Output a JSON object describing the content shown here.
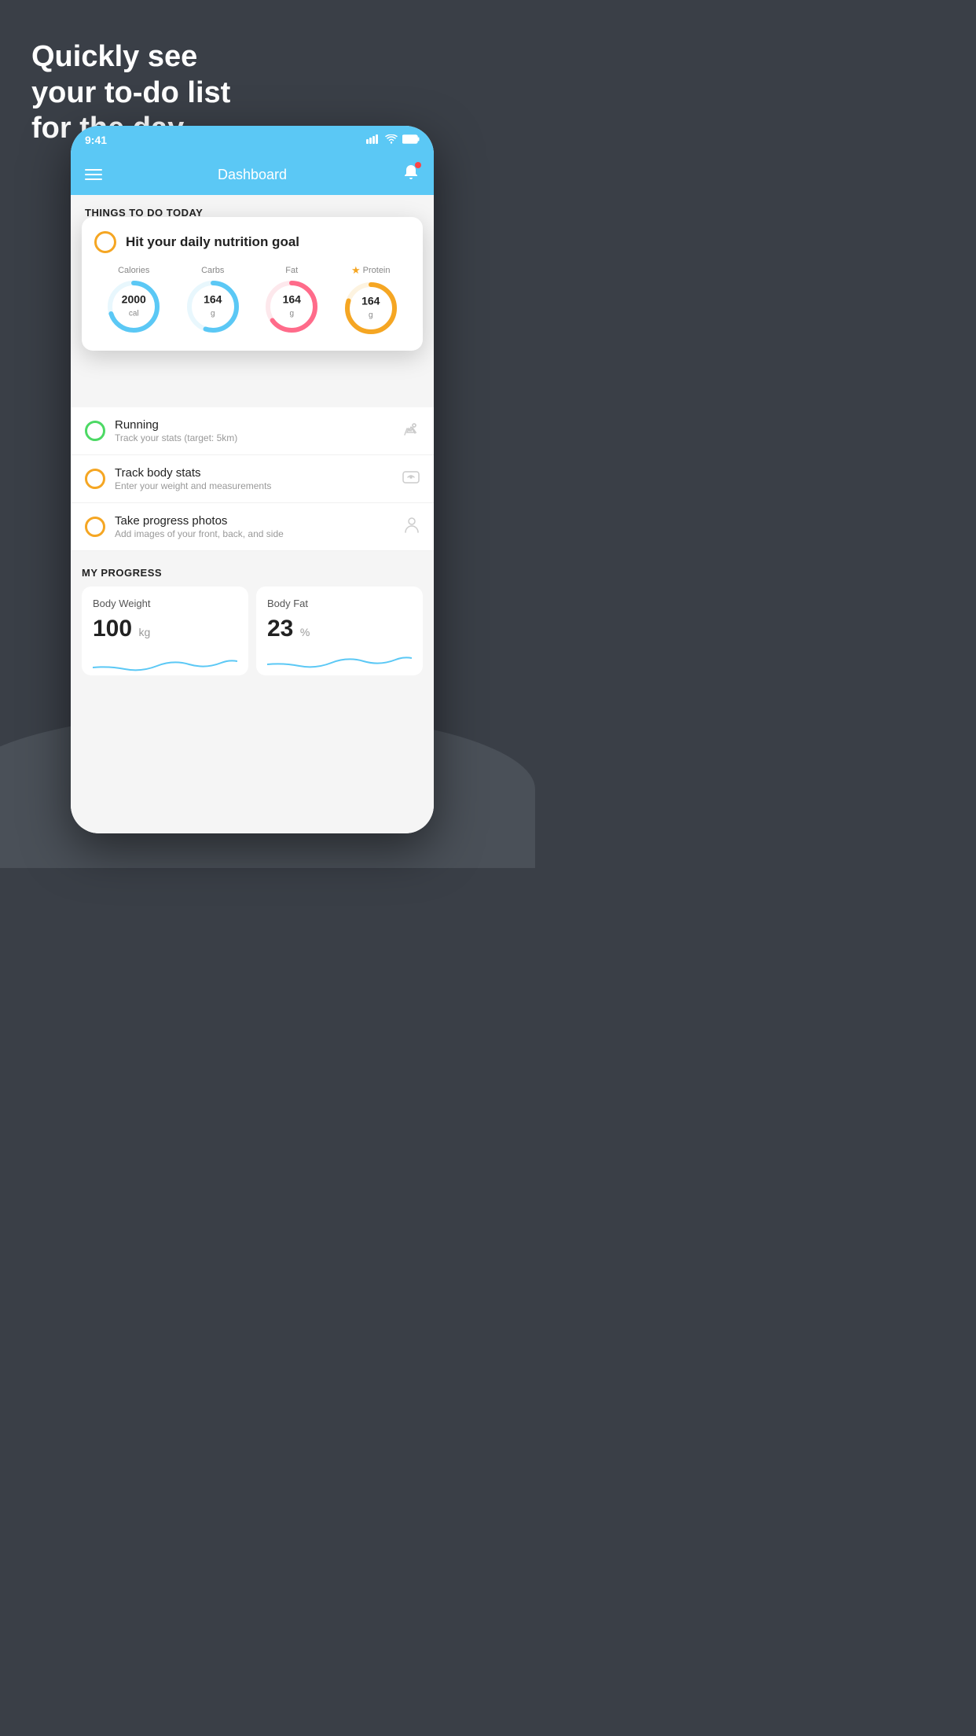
{
  "headline": {
    "line1": "Quickly see",
    "line2": "your to-do list",
    "line3": "for the day."
  },
  "status_bar": {
    "time": "9:41",
    "signal": "▌▌▌▌",
    "wifi": "wifi",
    "battery": "battery"
  },
  "nav": {
    "title": "Dashboard"
  },
  "todo_section": {
    "header": "THINGS TO DO TODAY"
  },
  "nutrition_card": {
    "title": "Hit your daily nutrition goal",
    "items": [
      {
        "label": "Calories",
        "value": "2000",
        "unit": "cal",
        "color": "#5bc8f5",
        "track_color": "#5bc8f5",
        "pct": 70
      },
      {
        "label": "Carbs",
        "value": "164",
        "unit": "g",
        "color": "#5bc8f5",
        "track_color": "#5bc8f5",
        "pct": 55
      },
      {
        "label": "Fat",
        "value": "164",
        "unit": "g",
        "color": "#ff6b8a",
        "track_color": "#ff6b8a",
        "pct": 65
      },
      {
        "label": "Protein",
        "value": "164",
        "unit": "g",
        "color": "#f5a623",
        "track_color": "#f5a623",
        "pct": 80,
        "star": true
      }
    ]
  },
  "todo_items": [
    {
      "id": "running",
      "name": "Running",
      "desc": "Track your stats (target: 5km)",
      "circle": "green",
      "icon": "👟"
    },
    {
      "id": "body-stats",
      "name": "Track body stats",
      "desc": "Enter your weight and measurements",
      "circle": "yellow",
      "icon": "⚖"
    },
    {
      "id": "photos",
      "name": "Take progress photos",
      "desc": "Add images of your front, back, and side",
      "circle": "yellow",
      "icon": "👤"
    }
  ],
  "progress_section": {
    "title": "MY PROGRESS",
    "cards": [
      {
        "id": "body-weight",
        "title": "Body Weight",
        "value": "100",
        "unit": "kg"
      },
      {
        "id": "body-fat",
        "title": "Body Fat",
        "value": "23",
        "unit": "%"
      }
    ]
  }
}
